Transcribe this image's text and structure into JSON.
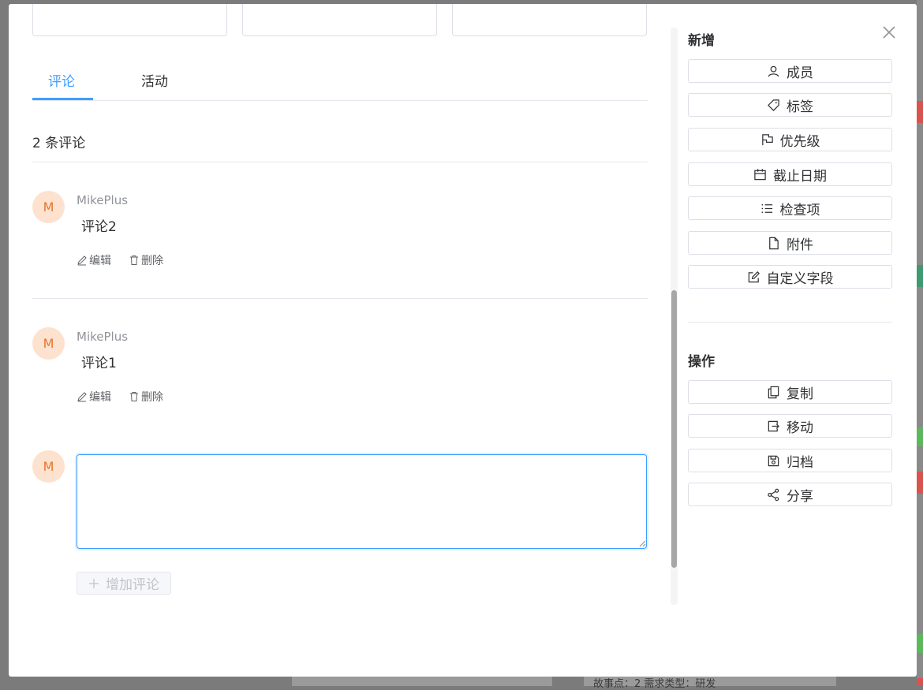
{
  "background": {
    "bottom_text": "故事点：2  需求类型：研发",
    "tag_colors": [
      "#d9534f",
      "#3f9a6f",
      "#5cb85c",
      "#d9534f",
      "#5cb85c",
      "#d9534f"
    ]
  },
  "tabs": [
    {
      "label": "评论",
      "active": true
    },
    {
      "label": "活动",
      "active": false
    }
  ],
  "comments_section": {
    "count_label": "2 条评论",
    "items": [
      {
        "avatar": "M",
        "author": "MikePlus",
        "text": "评论2",
        "edit_label": "编辑",
        "delete_label": "删除"
      },
      {
        "avatar": "M",
        "author": "MikePlus",
        "text": "评论1",
        "edit_label": "编辑",
        "delete_label": "删除"
      }
    ],
    "current_user_avatar": "M",
    "input_value": "",
    "add_button_label": "增加评论"
  },
  "sidebar": {
    "add_heading": "新增",
    "add_items": [
      {
        "label": "成员",
        "icon": "user-icon"
      },
      {
        "label": "标签",
        "icon": "tag-icon"
      },
      {
        "label": "优先级",
        "icon": "flag-icon"
      },
      {
        "label": "截止日期",
        "icon": "calendar-icon"
      },
      {
        "label": "检查项",
        "icon": "list-icon"
      },
      {
        "label": "附件",
        "icon": "file-icon"
      },
      {
        "label": "自定义字段",
        "icon": "edit-icon"
      }
    ],
    "ops_heading": "操作",
    "op_items": [
      {
        "label": "复制",
        "icon": "copy-icon"
      },
      {
        "label": "移动",
        "icon": "move-icon"
      },
      {
        "label": "归档",
        "icon": "archive-icon"
      },
      {
        "label": "分享",
        "icon": "share-icon"
      }
    ]
  },
  "colors": {
    "accent": "#409eff",
    "avatar_bg": "#fde2cf",
    "avatar_text": "#e6772e",
    "border": "#dcdfe6"
  }
}
